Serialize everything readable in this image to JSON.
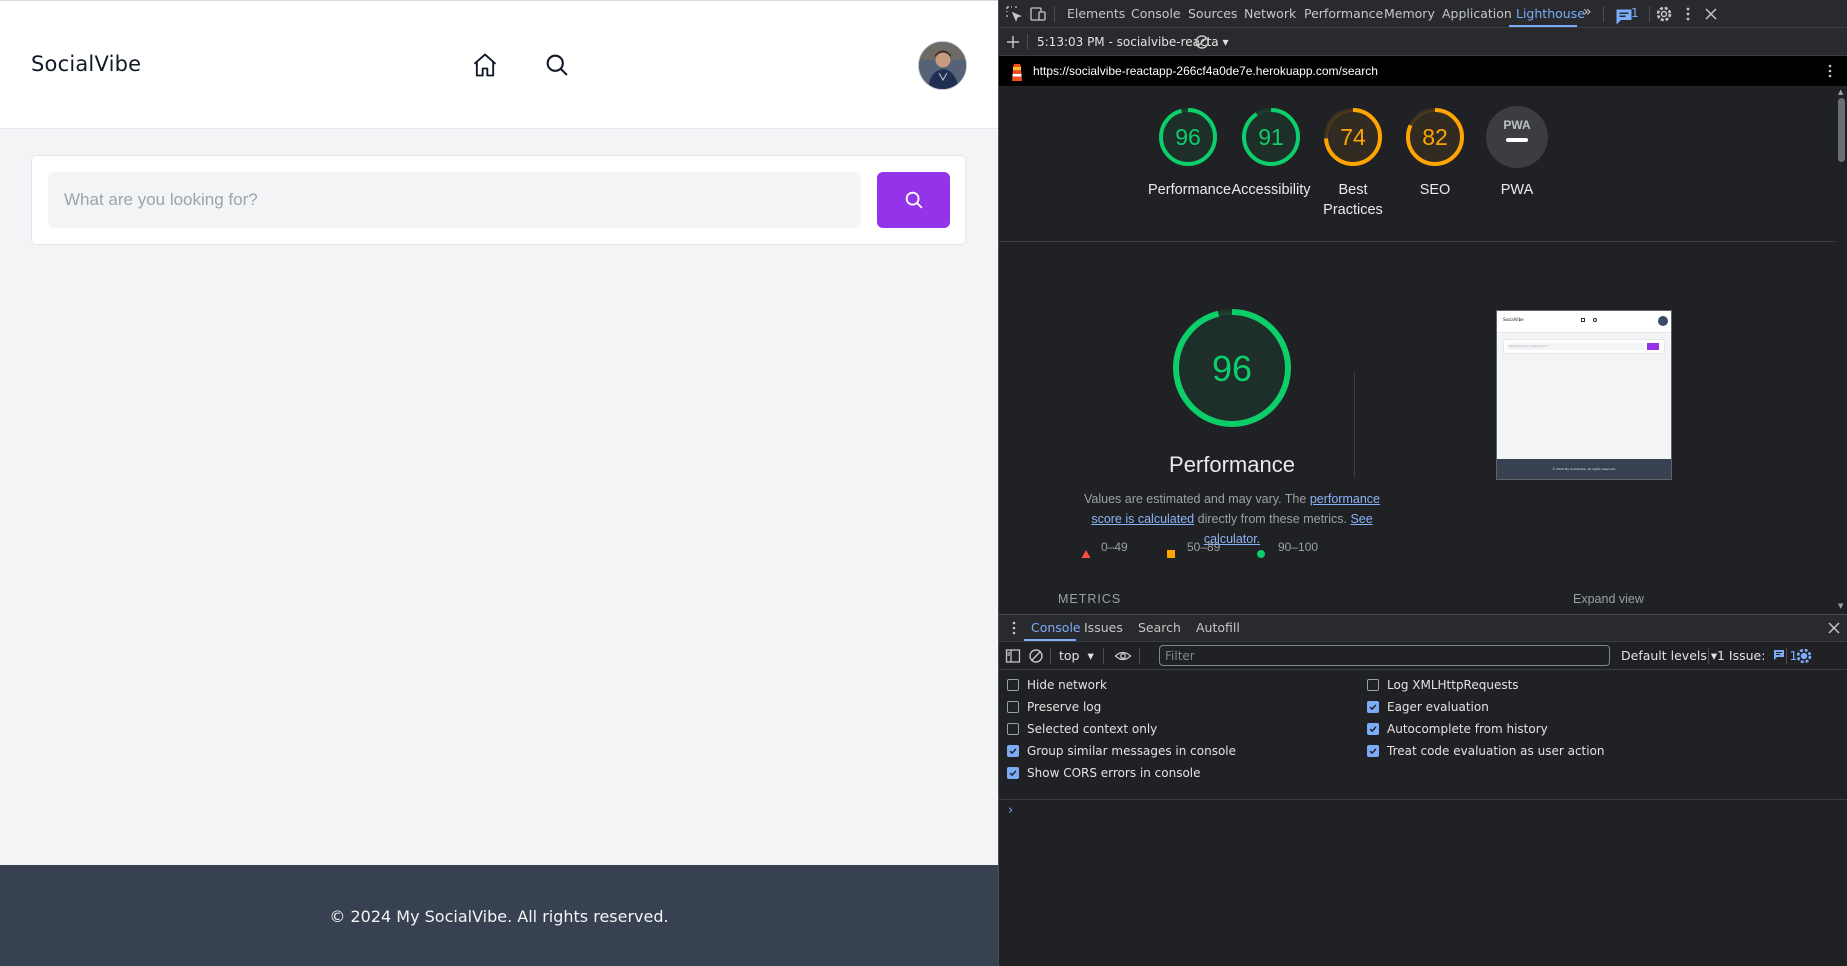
{
  "app": {
    "brand": "SocialVibe",
    "search": {
      "placeholder": "What are you looking for?"
    },
    "footer": "© 2024 My SocialVibe. All rights reserved."
  },
  "devtools": {
    "tabs": [
      "Elements",
      "Console",
      "Sources",
      "Network",
      "Performance",
      "Memory",
      "Application",
      "Lighthouse"
    ],
    "active_tab": "Lighthouse",
    "issues_badge": "1",
    "report_selector": "5:13:03 PM - socialvibe-reacta",
    "url": "https://socialvibe-reactapp-266cf4a0de7e.herokuapp.com/search",
    "scores": [
      {
        "label": "Performance",
        "value": "96",
        "fraction": 0.96,
        "color": "#0cce6b"
      },
      {
        "label": "Accessibility",
        "value": "91",
        "fraction": 0.91,
        "color": "#0cce6b"
      },
      {
        "label": "Best Practices",
        "value": "74",
        "fraction": 0.74,
        "color": "#ffa400"
      },
      {
        "label": "SEO",
        "value": "82",
        "fraction": 0.82,
        "color": "#ffa400"
      },
      {
        "label": "PWA",
        "value": "",
        "fraction": 0,
        "color": "#9aa0a6"
      }
    ],
    "pwa_badge_text": "PWA",
    "detail": {
      "score": "96",
      "title": "Performance",
      "desc_1": "Values are estimated and may vary. The ",
      "desc_link_1": "performance score is calculated",
      "desc_2": " directly from these metrics. ",
      "desc_link_2": "See calculator.",
      "legend": [
        "0–49",
        "50–89",
        "90–100"
      ],
      "metrics_label": "METRICS",
      "expand_label": "Expand view"
    },
    "thumbnail": {
      "brand": "SocialVibe",
      "placeholder": "What are you looking for?",
      "footer": "© 2024 My SocialVibe. All rights reserved."
    },
    "drawer": {
      "tabs": [
        "Console",
        "Issues",
        "Search",
        "Autofill"
      ],
      "active_tab": "Console",
      "context": "top",
      "filter_placeholder": "Filter",
      "levels": "Default levels",
      "issues_text": "1 Issue:",
      "issues_count": "1"
    },
    "console_settings": {
      "left": [
        {
          "label": "Hide network",
          "checked": false
        },
        {
          "label": "Preserve log",
          "checked": false
        },
        {
          "label": "Selected context only",
          "checked": false
        },
        {
          "label": "Group similar messages in console",
          "checked": true
        },
        {
          "label": "Show CORS errors in console",
          "checked": true
        }
      ],
      "right": [
        {
          "label": "Log XMLHttpRequests",
          "checked": false
        },
        {
          "label": "Eager evaluation",
          "checked": true
        },
        {
          "label": "Autocomplete from history",
          "checked": true
        },
        {
          "label": "Treat code evaluation as user action",
          "checked": true
        }
      ]
    }
  },
  "colors": {
    "accent_purple": "#9333ea",
    "footer_bg": "#374151",
    "score_green": "#0cce6b",
    "score_orange": "#ffa400",
    "score_red": "#ff4e42",
    "devtools_blue": "#7cacf8"
  }
}
